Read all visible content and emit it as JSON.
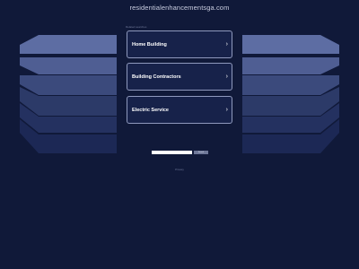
{
  "header": {
    "domain": "residentialenhancementsga.com"
  },
  "related": {
    "label": "Related searches",
    "links": [
      {
        "label": "Home Building"
      },
      {
        "label": "Building Contractors"
      },
      {
        "label": "Electric Service"
      }
    ]
  },
  "search": {
    "value": "",
    "button_label": "Search"
  },
  "footer": {
    "privacy_label": "Privacy"
  },
  "icons": {
    "chevron": "chevron-right-icon"
  },
  "colors": {
    "background": "#101939",
    "card_border": "#8f99bd",
    "card_fill": "#17224a",
    "deco_light": "#5d6da3",
    "deco_dark": "#1b2650"
  }
}
